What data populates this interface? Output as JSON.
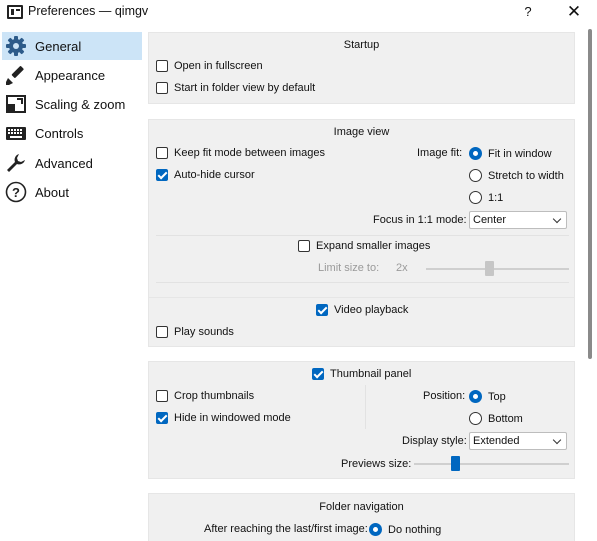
{
  "window": {
    "title": "Preferences — qimgv",
    "help_label": "?",
    "close_label": "✕"
  },
  "sidebar": {
    "items": [
      {
        "label": "General",
        "icon": "gear-icon",
        "selected": true
      },
      {
        "label": "Appearance",
        "icon": "paintbrush-icon",
        "selected": false
      },
      {
        "label": "Scaling & zoom",
        "icon": "resize-icon",
        "selected": false
      },
      {
        "label": "Controls",
        "icon": "keyboard-icon",
        "selected": false
      },
      {
        "label": "Advanced",
        "icon": "wrench-icon",
        "selected": false
      },
      {
        "label": "About",
        "icon": "question-icon",
        "selected": false
      }
    ]
  },
  "startup": {
    "title": "Startup",
    "open_fullscreen": {
      "label": "Open in fullscreen",
      "checked": false
    },
    "folder_view": {
      "label": "Start in folder view by default",
      "checked": false
    }
  },
  "image_view": {
    "title": "Image view",
    "keep_fit": {
      "label": "Keep fit mode between images",
      "checked": false
    },
    "autohide_cursor": {
      "label": "Auto-hide cursor",
      "checked": true
    },
    "image_fit_label": "Image fit:",
    "fit_options": [
      {
        "label": "Fit in window",
        "checked": true
      },
      {
        "label": "Stretch to width",
        "checked": false
      },
      {
        "label": "1:1",
        "checked": false
      }
    ],
    "focus_label": "Focus in 1:1 mode:",
    "focus_value": "Center",
    "expand_smaller": {
      "label": "Expand smaller images",
      "checked": false
    },
    "limit_label": "Limit size to:",
    "limit_value": "2x"
  },
  "video": {
    "video_playback": {
      "label": "Video playback",
      "checked": true
    },
    "play_sounds": {
      "label": "Play sounds",
      "checked": false
    }
  },
  "thumbnails": {
    "panel": {
      "label": "Thumbnail panel",
      "checked": true
    },
    "crop": {
      "label": "Crop thumbnails",
      "checked": false
    },
    "hide_windowed": {
      "label": "Hide in windowed mode",
      "checked": true
    },
    "position_label": "Position:",
    "position_options": [
      {
        "label": "Top",
        "checked": true
      },
      {
        "label": "Bottom",
        "checked": false
      }
    ],
    "display_style_label": "Display style:",
    "display_style_value": "Extended",
    "previews_size_label": "Previews size:"
  },
  "folder_navigation": {
    "title": "Folder navigation",
    "after_last_label": "After reaching the last/first image:",
    "do_nothing": {
      "label": "Do nothing",
      "checked": true
    }
  },
  "colors": {
    "accent": "#0067c0",
    "selection": "#cce4f7",
    "group_bg": "#f0f0f0"
  }
}
